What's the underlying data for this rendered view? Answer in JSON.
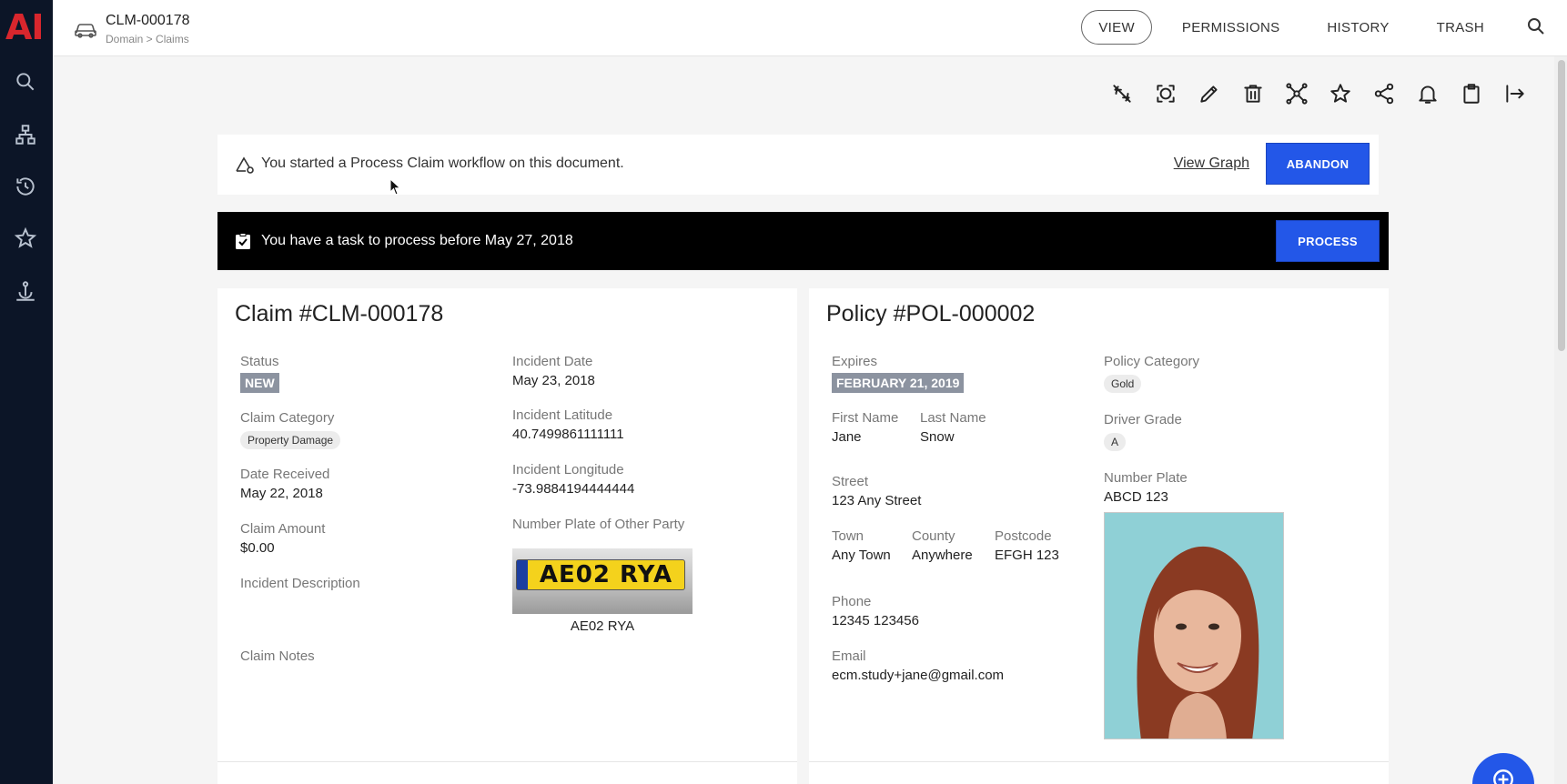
{
  "app": {
    "logo": "AI"
  },
  "header": {
    "doc_id": "CLM-000178",
    "breadcrumb": "Domain > Claims",
    "tabs": [
      {
        "label": "VIEW",
        "active": true
      },
      {
        "label": "PERMISSIONS",
        "active": false
      },
      {
        "label": "HISTORY",
        "active": false
      },
      {
        "label": "TRASH",
        "active": false
      }
    ]
  },
  "left_nav": [
    "search-icon",
    "hierarchy-icon",
    "history-icon",
    "star-icon",
    "anchor-icon"
  ],
  "toolbar": [
    "sync-off-icon",
    "focus-icon",
    "edit-icon",
    "delete-icon",
    "workflow-icon",
    "star-icon",
    "share-icon",
    "bell-icon",
    "clipboard-icon",
    "export-icon"
  ],
  "workflow_banner": {
    "text": "You started a Process Claim workflow on this document.",
    "link": "View Graph",
    "button": "ABANDON"
  },
  "task_banner": {
    "text": "You have a task to process before May 27, 2018",
    "button": "PROCESS"
  },
  "claim": {
    "title": "Claim #CLM-000178",
    "status_label": "Status",
    "status": "NEW",
    "category_label": "Claim Category",
    "category": "Property Damage",
    "received_label": "Date Received",
    "received": "May 22, 2018",
    "amount_label": "Claim Amount",
    "amount": "$0.00",
    "description_label": "Incident Description",
    "notes_label": "Claim Notes",
    "incident_date_label": "Incident Date",
    "incident_date": "May 23, 2018",
    "latitude_label": "Incident Latitude",
    "latitude": "40.7499861111111",
    "longitude_label": "Incident Longitude",
    "longitude": "-73.9884194444444",
    "plate_label": "Number Plate of Other Party",
    "plate_image_text": "AE02 RYA",
    "plate_caption": "AE02 RYA"
  },
  "policy": {
    "title": "Policy #POL-000002",
    "expires_label": "Expires",
    "expires": "FEBRUARY 21, 2019",
    "first_name_label": "First Name",
    "first_name": "Jane",
    "last_name_label": "Last Name",
    "last_name": "Snow",
    "street_label": "Street",
    "street": "123 Any Street",
    "town_label": "Town",
    "town": "Any Town",
    "county_label": "County",
    "county": "Anywhere",
    "postcode_label": "Postcode",
    "postcode": "EFGH 123",
    "phone_label": "Phone",
    "phone": "12345 123456",
    "email_label": "Email",
    "email": "ecm.study+jane@gmail.com",
    "category_label": "Policy Category",
    "category": "Gold",
    "driver_grade_label": "Driver Grade",
    "driver_grade": "A",
    "number_plate_label": "Number Plate",
    "number_plate": "ABCD 123"
  },
  "colors": {
    "nav_bg": "#0c1527",
    "accent": "#2357e8",
    "logo": "#d9262d"
  }
}
